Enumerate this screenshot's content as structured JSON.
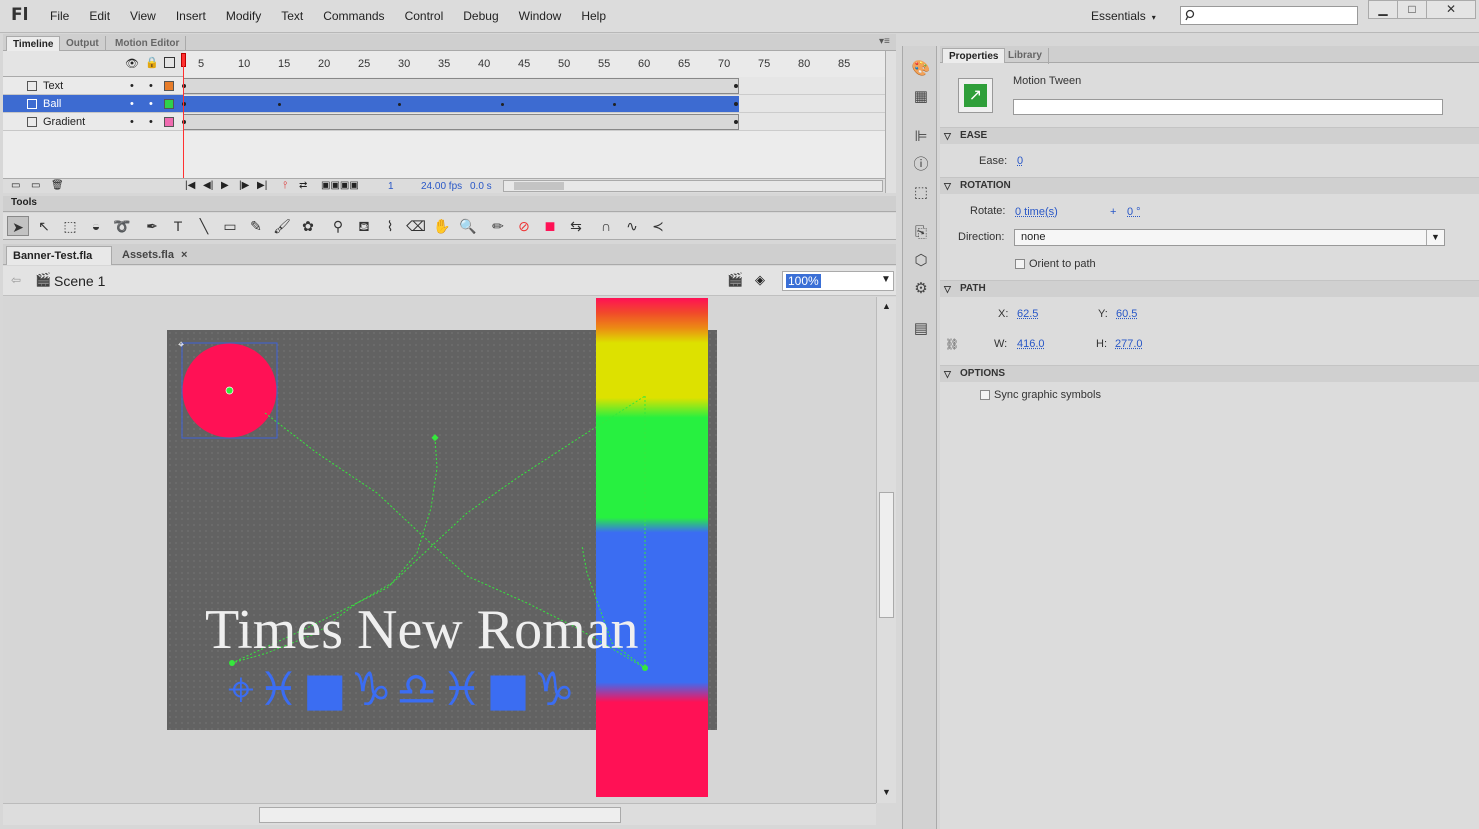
{
  "app": {
    "logo": "Fl"
  },
  "menu": [
    "File",
    "Edit",
    "View",
    "Insert",
    "Modify",
    "Text",
    "Commands",
    "Control",
    "Debug",
    "Window",
    "Help"
  ],
  "workspace": {
    "label": "Essentials",
    "arrow": "▾"
  },
  "window_buttons": {
    "minimize": "▁",
    "restore": "□",
    "close": "✕"
  },
  "panel_tabs": {
    "timeline": "Timeline",
    "output": "Output",
    "motion_editor": "Motion Editor"
  },
  "timeline": {
    "ruler": [
      "5",
      "10",
      "15",
      "20",
      "25",
      "30",
      "35",
      "40",
      "45",
      "50",
      "55",
      "60",
      "65",
      "70",
      "75",
      "80",
      "85"
    ],
    "layers": [
      {
        "name": "Text",
        "selected": false
      },
      {
        "name": "Ball",
        "selected": true
      },
      {
        "name": "Gradient",
        "selected": false
      }
    ],
    "current_frame": "1",
    "fps": "24.00 fps",
    "time": "0.0 s"
  },
  "tools_label": "Tools",
  "tools": [
    "selection-icon",
    "subselection-icon",
    "free-transform-icon",
    "3d-rotation-icon",
    "lasso-icon",
    "pen-icon",
    "text-icon",
    "line-icon",
    "rectangle-icon",
    "pencil-icon",
    "brush-icon",
    "deco-icon",
    "bone-icon",
    "paint-bucket-icon",
    "eyedropper-icon",
    "eraser-icon",
    "hand-icon",
    "zoom-icon",
    "stroke-color-icon",
    "no-color-icon",
    "fill-color-icon",
    "swap-colors-icon",
    "snap-icon",
    "smooth-icon",
    "straighten-icon"
  ],
  "documents": {
    "tab1": "Banner-Test.fla",
    "tab2": "Assets.fla",
    "close": "×"
  },
  "scene": {
    "name": "Scene 1",
    "zoom": "100%"
  },
  "stage": {
    "text": "Times New Roman",
    "glyphs": "⌖♓■♑♎♓■♑",
    "ball_color": "#ff1155",
    "symbol_color": "#3b6df2",
    "path_color": "#35e83c"
  },
  "properties": {
    "tab_properties": "Properties",
    "tab_library": "Library",
    "type": "Motion Tween",
    "instance_name": "",
    "ease_section": "EASE",
    "ease_label": "Ease:",
    "ease_value": "0",
    "rotation_section": "ROTATION",
    "rotate_label": "Rotate:",
    "rotate_times": "0 time(s)",
    "rotate_plus": "+",
    "rotate_deg": "0 °",
    "direction_label": "Direction:",
    "direction_value": "none",
    "orient_label": "Orient to path",
    "path_section": "PATH",
    "x_label": "X:",
    "x_value": "62.5",
    "y_label": "Y:",
    "y_value": "60.5",
    "w_label": "W:",
    "w_value": "416.0",
    "h_label": "H:",
    "h_value": "277.0",
    "options_section": "OPTIONS",
    "sync_label": "Sync graphic symbols"
  }
}
